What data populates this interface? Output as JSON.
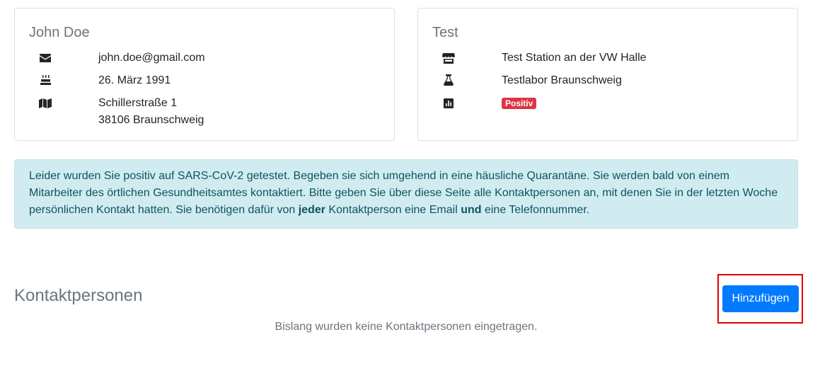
{
  "patient": {
    "name": "John Doe",
    "email": "john.doe@gmail.com",
    "birthday": "26. März 1991",
    "address_line1": "Schillerstraße 1",
    "address_line2": "38106 Braunschweig",
    "icons": [
      "envelope-icon",
      "birthday-cake-icon",
      "map-icon"
    ]
  },
  "test": {
    "title": "Test",
    "station": "Test Station an der VW Halle",
    "lab": "Testlabor Braunschweig",
    "result": "Positiv",
    "result_color": "#dc3545",
    "icons": [
      "store-icon",
      "flask-icon",
      "chart-icon"
    ]
  },
  "alert": {
    "text_part1": "Leider wurden Sie positiv auf SARS-CoV-2 getestet. Begeben sie sich umgehend in eine häusliche Quarantäne. Sie werden bald von einem Mitarbeiter des örtlichen Gesundheitsamtes kontaktiert. Bitte geben Sie über diese Seite alle Kontaktpersonen an, mit denen Sie in der letzten Woche persönlichen Kontakt hatten. Sie benötigen dafür von ",
    "bold1": "jeder",
    "text_part2": " Kontaktperson eine Email ",
    "bold2": "und",
    "text_part3": " eine Telefonnummer.",
    "background": "#d1ecf1",
    "color": "#0c5460"
  },
  "contacts": {
    "title": "Kontaktpersonen",
    "add_label": "Hinzufügen",
    "add_color": "#007bff",
    "empty_text": "Bislang wurden keine Kontaktpersonen eingetragen."
  }
}
